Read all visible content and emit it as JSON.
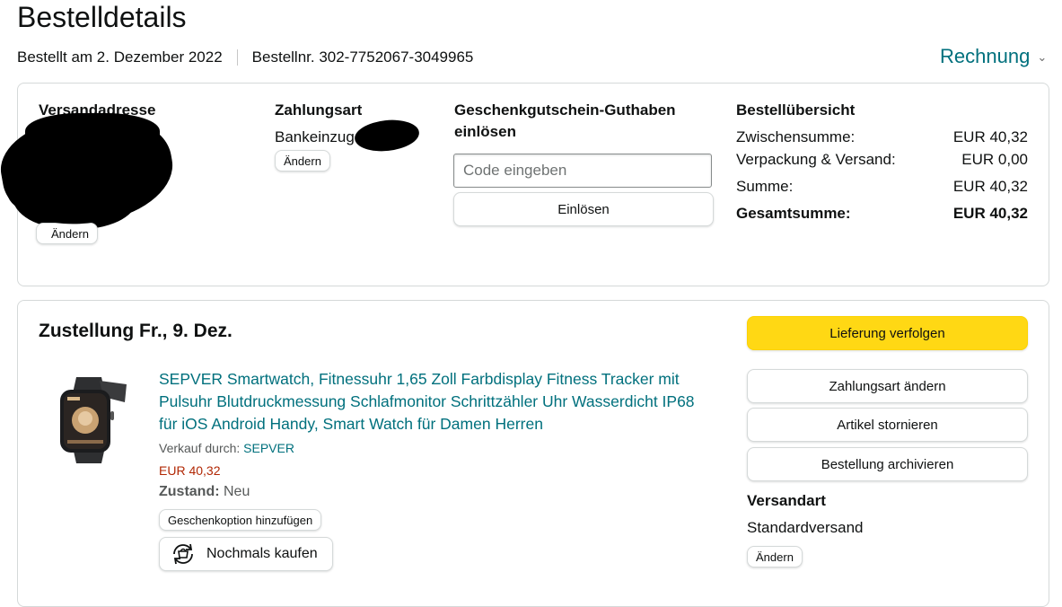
{
  "page": {
    "title": "Bestelldetails",
    "ordered_on": "Bestellt am 2. Dezember 2022",
    "order_number": "Bestellnr. 302-7752067-3049965",
    "invoice_label": "Rechnung",
    "invoice_icon": "chevron-down-icon"
  },
  "shipping_address": {
    "heading": "Versandadresse",
    "change_label": "Ändern"
  },
  "payment": {
    "heading": "Zahlungsart",
    "method": "Bankeinzug",
    "change_label": "Ändern"
  },
  "gift_card": {
    "heading_line1": "Geschenkgutschein-Guthaben",
    "heading_line2": "einlösen",
    "placeholder": "Code eingeben",
    "redeem_label": "Einlösen"
  },
  "summary": {
    "heading": "Bestellübersicht",
    "rows": [
      {
        "label": "Zwischensumme:",
        "value": "EUR 40,32"
      },
      {
        "label": "Verpackung & Versand:",
        "value": "EUR 0,00"
      },
      {
        "label": "Summe:",
        "value": "EUR 40,32"
      },
      {
        "label": "Gesamtsumme:",
        "value": "EUR 40,32"
      }
    ]
  },
  "delivery": {
    "heading": "Zustellung Fr., 9. Dez.",
    "product": {
      "title_line1": "SEPVER Smartwatch, Fitnessuhr 1,65 Zoll Farbdisplay Fitness Tracker mit",
      "title_line2": "Pulsuhr Blutdruckmessung Schlafmonitor Schrittzähler Uhr Wasserdicht IP68",
      "title_line3": "für iOS Android Handy, Smart Watch für Damen Herren",
      "sold_by_label": "Verkauf durch:",
      "seller": "SEPVER",
      "price": "EUR 40,32",
      "condition_label": "Zustand:",
      "condition_value": "Neu",
      "gift_option_label": "Geschenkoption hinzufügen",
      "buy_again_label": "Nochmals kaufen",
      "buy_again_icon": "buy-again-icon"
    },
    "actions": {
      "track": "Lieferung verfolgen",
      "change_payment": "Zahlungsart ändern",
      "cancel_items": "Artikel stornieren",
      "archive_order": "Bestellung archivieren"
    },
    "shipping_method": {
      "heading": "Versandart",
      "value": "Standardversand",
      "change_label": "Ändern"
    }
  },
  "colors": {
    "link": "#00707d",
    "price": "#b12704",
    "track_button": "#ffd814"
  }
}
